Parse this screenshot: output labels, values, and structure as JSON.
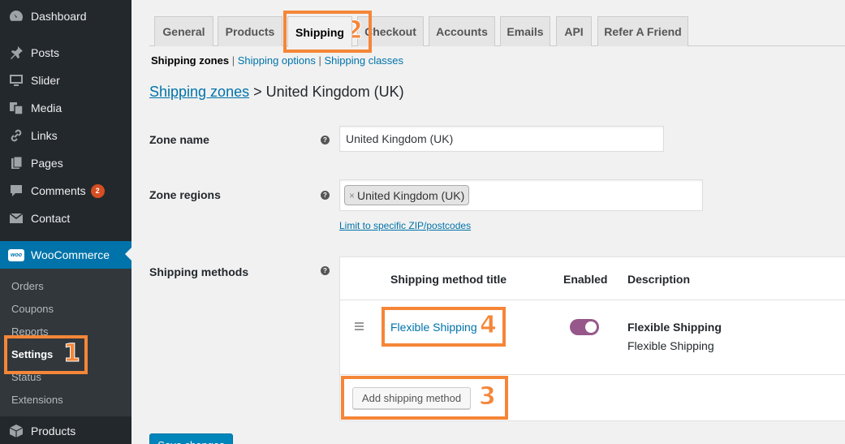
{
  "sidebar": {
    "items": [
      {
        "label": "Dashboard",
        "icon": "dashboard-icon"
      },
      {
        "label": "Posts",
        "icon": "pin-icon"
      },
      {
        "label": "Slider",
        "icon": "monitor-icon"
      },
      {
        "label": "Media",
        "icon": "media-icon"
      },
      {
        "label": "Links",
        "icon": "link-icon"
      },
      {
        "label": "Pages",
        "icon": "pages-icon"
      },
      {
        "label": "Comments",
        "icon": "comment-icon",
        "badge": "2"
      },
      {
        "label": "Contact",
        "icon": "mail-icon"
      },
      {
        "label": "WooCommerce",
        "icon": "woo-icon",
        "icon_text": "woo"
      },
      {
        "label": "Products",
        "icon": "box-icon"
      }
    ],
    "submenu": [
      "Orders",
      "Coupons",
      "Reports",
      "Settings",
      "Status",
      "Extensions"
    ]
  },
  "tabs": [
    "General",
    "Products",
    "Shipping",
    "Checkout",
    "Accounts",
    "Emails",
    "API",
    "Refer A Friend"
  ],
  "subnav": {
    "current": "Shipping zones",
    "sep": "|",
    "links": [
      "Shipping options",
      "Shipping classes"
    ]
  },
  "heading": {
    "link": "Shipping zones",
    "rest": " > United Kingdom (UK)"
  },
  "form": {
    "zone_name_label": "Zone name",
    "zone_name_value": "United Kingdom (UK)",
    "zone_regions_label": "Zone regions",
    "zone_region_chip": "United Kingdom (UK)",
    "chip_remove": "×",
    "zip_link": "Limit to specific ZIP/postcodes",
    "shipping_methods_label": "Shipping methods",
    "help": "?"
  },
  "methods_table": {
    "headers": [
      "Shipping method title",
      "Enabled",
      "Description"
    ],
    "rows": [
      {
        "title": "Flexible Shipping",
        "enabled": true,
        "desc_title": "Flexible Shipping",
        "desc": "Flexible Shipping"
      }
    ],
    "add_button": "Add shipping method"
  },
  "save_button": "Save changes",
  "callouts": [
    "1",
    "2",
    "3",
    "4"
  ],
  "colors": {
    "accent": "#0073aa",
    "callout": "#f58638",
    "toggle": "#96588a",
    "sidebar": "#23282d"
  }
}
